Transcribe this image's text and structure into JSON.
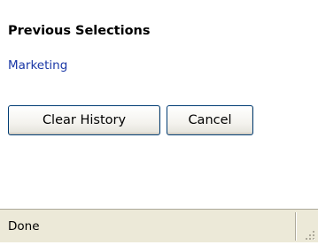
{
  "panel": {
    "heading": "Previous Selections",
    "selections": [
      "Marketing"
    ]
  },
  "buttons": {
    "clear_history": "Clear History",
    "cancel": "Cancel"
  },
  "status_bar": {
    "text": "Done",
    "resize_icon": "resize-grip-icon"
  },
  "colors": {
    "link": "#1a37a6",
    "status_background": "#ece9d8",
    "button_border": "#003c74"
  }
}
